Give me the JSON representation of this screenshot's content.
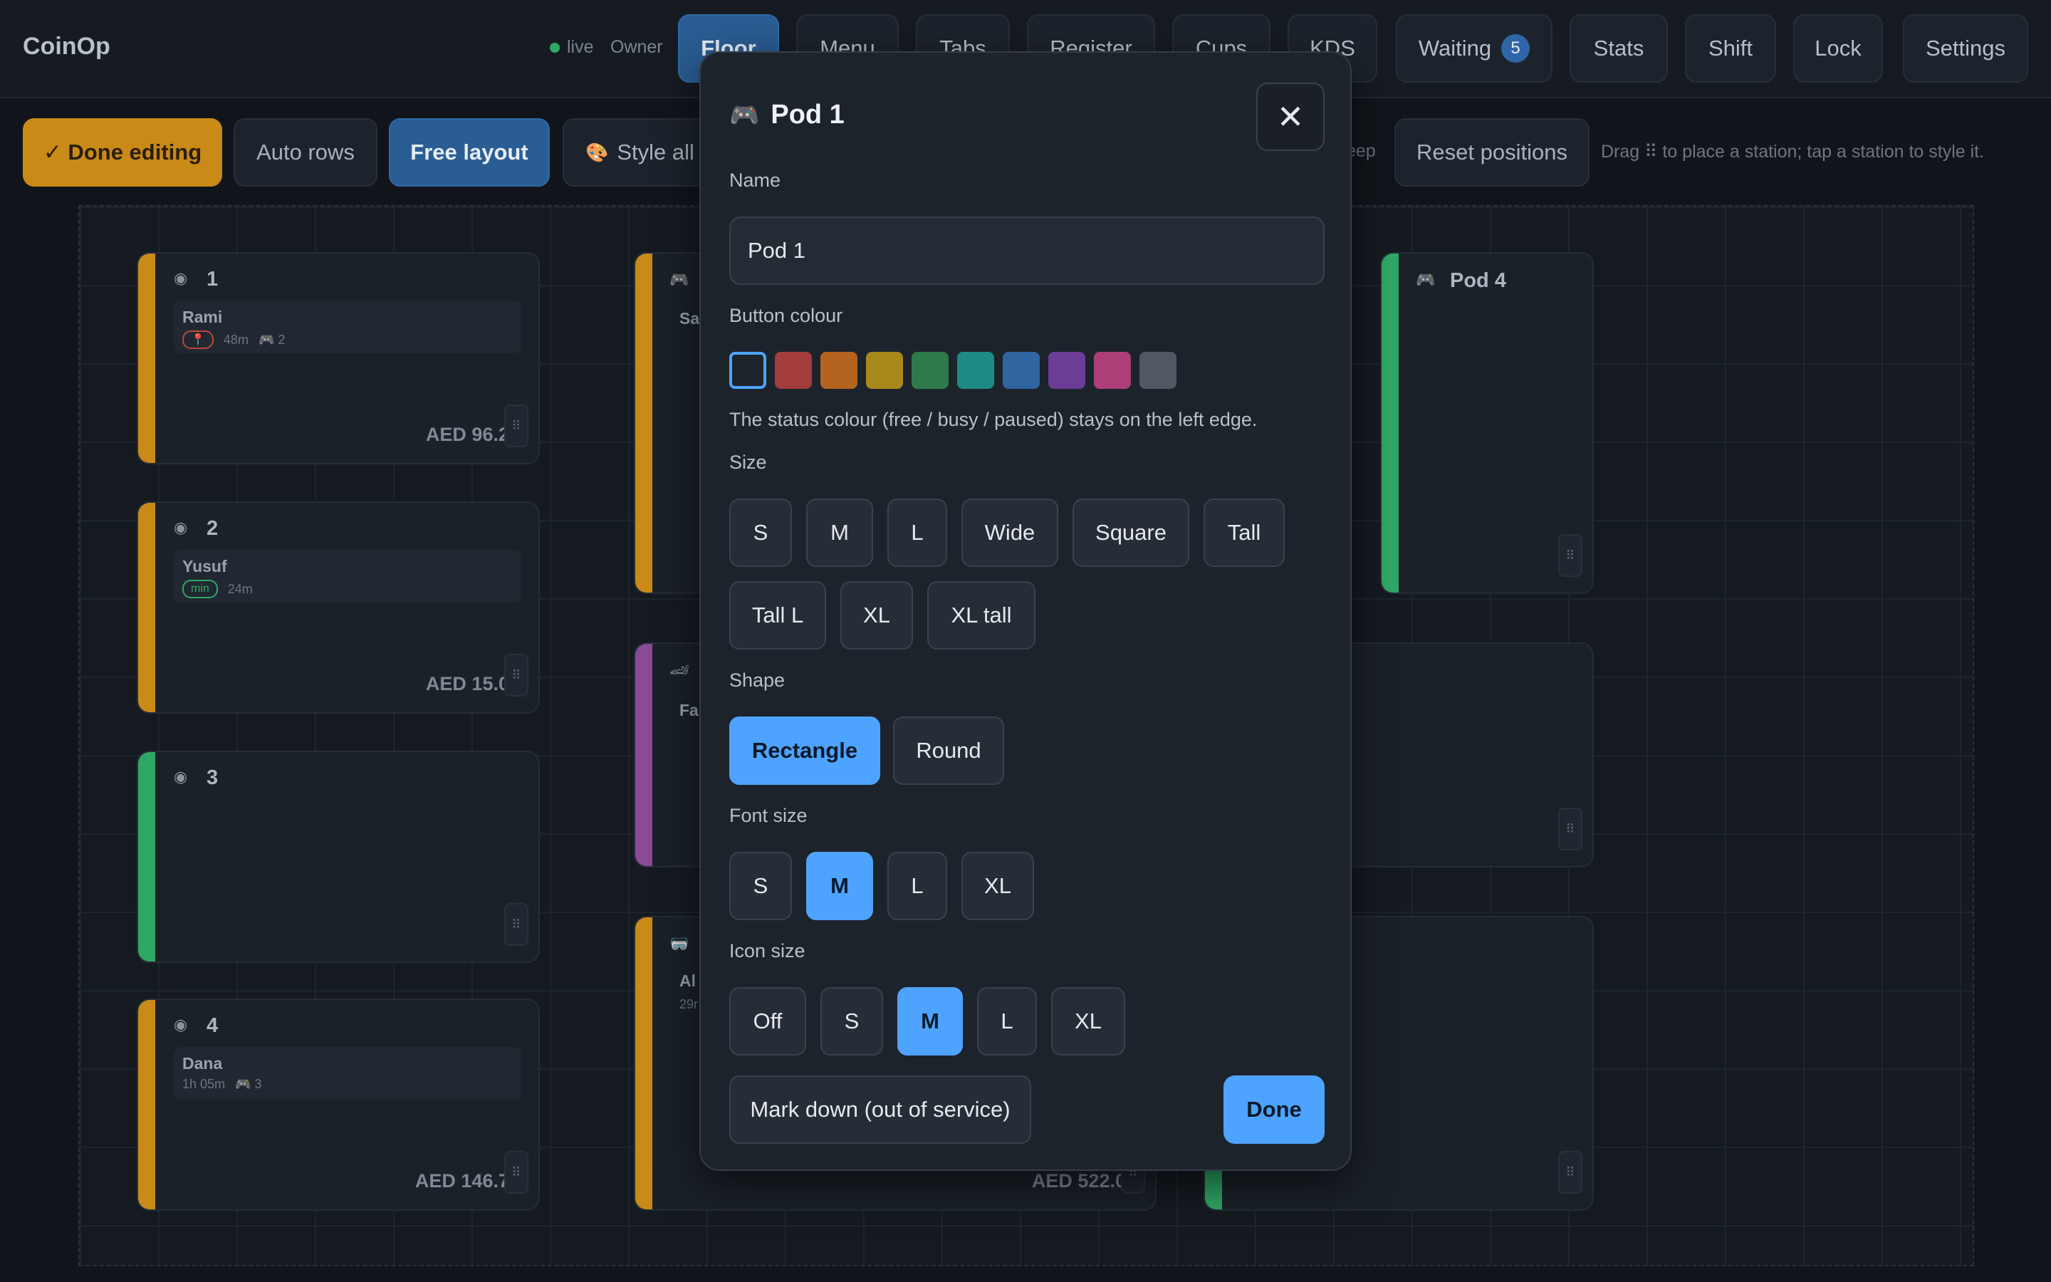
{
  "app": {
    "title": "CoinOp",
    "status": "live",
    "role": "Owner"
  },
  "nav": {
    "tabs": [
      "Floor",
      "Menu",
      "Tabs",
      "Register",
      "Cups",
      "KDS",
      "Waiting",
      "Stats",
      "Shift",
      "Lock",
      "Settings"
    ],
    "waiting_count": "5"
  },
  "toolbar": {
    "done_editing": "✓ Done editing",
    "auto_rows": "Auto rows",
    "free_layout": "Free layout",
    "style_all": "Style all",
    "keep": "eep",
    "reset_positions": "Reset positions",
    "hint": "Drag ⠿ to place a station; tap a station to style it."
  },
  "floor": {
    "stations": [
      {
        "name": "1",
        "customer": "Rami",
        "time": "48m",
        "count": "2",
        "amount": "AED 96.25",
        "status_color": "#c98a18"
      },
      {
        "name": "2",
        "customer": "Yusuf",
        "tag": "min",
        "time": "24m",
        "amount": "AED 15.00",
        "status_color": "#c98a18"
      },
      {
        "name": "3",
        "status_color": "#2fa866"
      },
      {
        "name": "4",
        "customer": "Dana",
        "time": "1h 05m",
        "count": "3",
        "amount": "AED 146.75",
        "status_color": "#c98a18"
      },
      {
        "name": "Pod 4",
        "status_color": "#2fa866"
      },
      {
        "customer_partial_a": "Sa",
        "customer_partial_b": "Fa",
        "customer_partial_c": "Al",
        "time_partial": "29r",
        "amount": "AED 522.00"
      }
    ]
  },
  "modal": {
    "title": "Pod 1",
    "name_label": "Name",
    "name_value": "Pod 1",
    "colour_label": "Button colour",
    "colours": [
      "#1d232b",
      "#a33c3c",
      "#b4641e",
      "#a8891c",
      "#2f7a4a",
      "#1f8a84",
      "#2f65a1",
      "#6c3d96",
      "#ad3f78",
      "#4f5863"
    ],
    "colour_note": "The status colour (free / busy / paused) stays on the left edge.",
    "size_label": "Size",
    "sizes": [
      "S",
      "M",
      "L",
      "Wide",
      "Square",
      "Tall",
      "Tall L",
      "XL",
      "XL tall"
    ],
    "shape_label": "Shape",
    "shapes": [
      "Rectangle",
      "Round"
    ],
    "shape_selected": "Rectangle",
    "font_label": "Font size",
    "fonts": [
      "S",
      "M",
      "L",
      "XL"
    ],
    "font_selected": "M",
    "icon_label": "Icon size",
    "icons": [
      "Off",
      "S",
      "M",
      "L",
      "XL"
    ],
    "icon_selected": "M",
    "mark_down": "Mark down (out of service)",
    "done": "Done"
  }
}
